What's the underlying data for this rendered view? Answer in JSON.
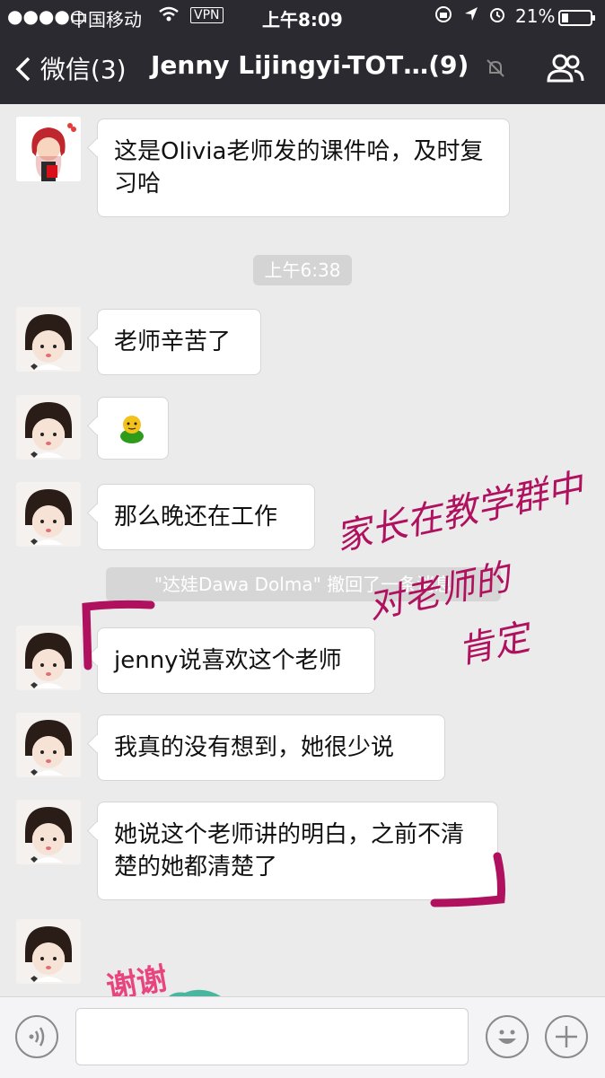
{
  "status_bar": {
    "signal": "●●●●○",
    "carrier": "中国移动",
    "vpn": "VPN",
    "time": "上午8:09",
    "battery": "21%"
  },
  "nav": {
    "back_label": "微信(3)",
    "title": "Jenny Lijingyi-TOT…(9)"
  },
  "messages": [
    {
      "text": "这是Olivia老师发的课件哈，及时复习哈"
    },
    {
      "timestamp": "上午6:38"
    },
    {
      "text": "老师辛苦了"
    },
    {
      "text": "🐥"
    },
    {
      "text": "那么晚还在工作"
    },
    {
      "recall": "\"达娃Dawa Dolma\" 撤回了一条消息"
    },
    {
      "text": "jenny说喜欢这个老师"
    },
    {
      "text": "我真的没有想到，她很少说"
    },
    {
      "text": "她说这个老师讲的明白，之前不清楚的她都清楚了"
    },
    {
      "sticker": "谢谢"
    }
  ],
  "annotation": {
    "line1": "家长在教学群中",
    "line2": "对老师的",
    "line3": "肯定"
  },
  "colors": {
    "header_bg": "#2b2a30",
    "annotation": "#b0115f",
    "background": "#ebebeb"
  }
}
